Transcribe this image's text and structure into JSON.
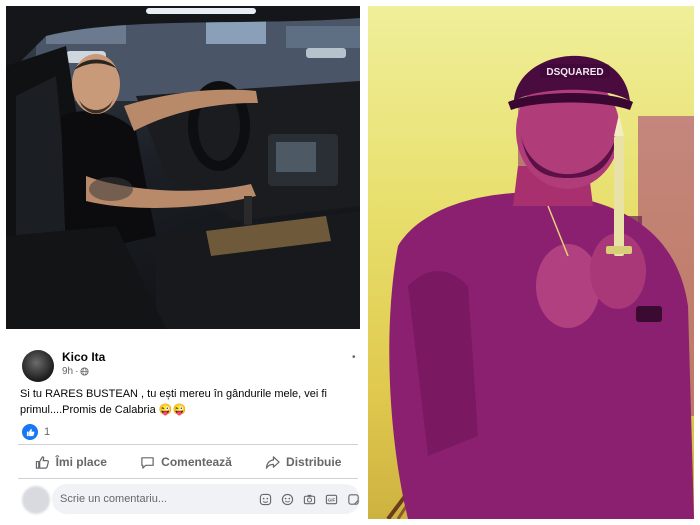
{
  "post": {
    "author": "Kico Ita",
    "time": "9h",
    "text": "Si tu RARES BUSTEAN , tu ești mereu în gândurile mele, vei fi primul....Promis de Calabria 😜😜",
    "like_count": "1",
    "actions": {
      "like": "Îmi place",
      "comment": "Comentează",
      "share": "Distribuie"
    },
    "comment_placeholder": "Scrie un comentariu..."
  },
  "photos": {
    "right_cap_text": "DSQUARED"
  },
  "icons": [
    "globe-icon",
    "like-icon",
    "comment-icon",
    "share-icon",
    "emoji-icon",
    "camera-icon",
    "gif-icon",
    "sticker-icon",
    "more-icon"
  ],
  "colors": {
    "fb_blue": "#1877f2",
    "grey_text": "#65676b",
    "input_bg": "#f0f2f5"
  }
}
